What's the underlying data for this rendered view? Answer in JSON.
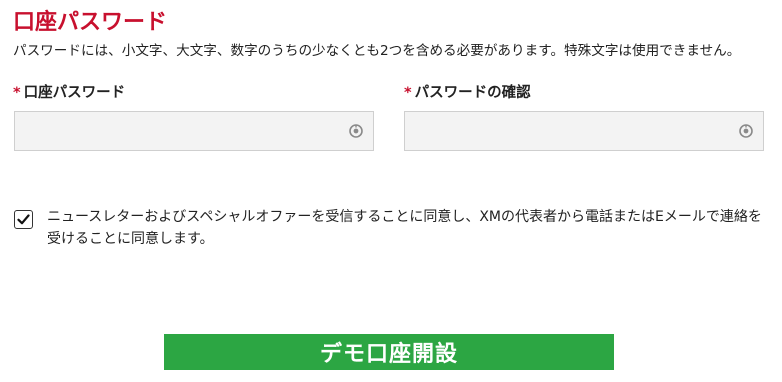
{
  "section": {
    "title": "口座パスワード",
    "description": "パスワードには、小文字、大文字、数字のうちの少なくとも2つを含める必要があります。特殊文字は使用できません。"
  },
  "fields": {
    "required_marker": "*",
    "password_label": "口座パスワード",
    "password_value": "",
    "confirm_label": "パスワードの確認",
    "confirm_value": "",
    "toggle_icon": "eye-toggle-icon"
  },
  "consent": {
    "checked": true,
    "text": "ニュースレターおよびスペシャルオファーを受信することに同意し、XMの代表者から電話またはEメールで連絡を受けることに同意します。"
  },
  "submit": {
    "label": "デモ口座開設",
    "color": "#2ca643"
  },
  "colors": {
    "accent": "#c8102e",
    "input_bg": "#f3f3f3"
  }
}
